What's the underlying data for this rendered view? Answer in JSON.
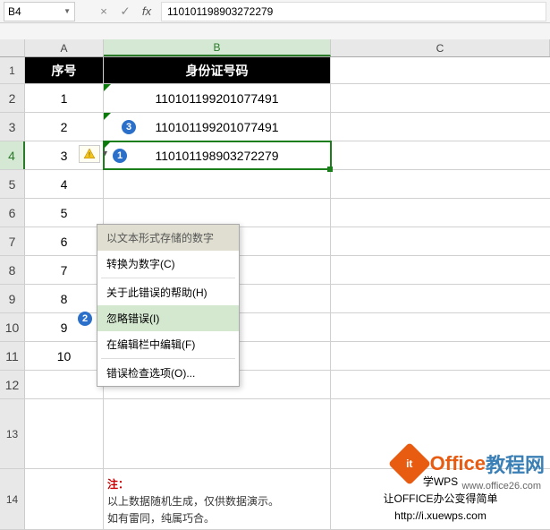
{
  "formula_bar": {
    "name_box": "B4",
    "cancel_icon": "×",
    "confirm_icon": "✓",
    "fx_label": "fx",
    "formula_value": "110101198903272279"
  },
  "columns": {
    "a": "A",
    "b": "B",
    "c": "C"
  },
  "row_headers": [
    "1",
    "2",
    "3",
    "4",
    "5",
    "6",
    "7",
    "8",
    "9",
    "10",
    "11",
    "12",
    "13",
    "14"
  ],
  "header_row": {
    "seq": "序号",
    "id": "身份证号码"
  },
  "rows": [
    {
      "seq": "1",
      "id": "110101199201077491"
    },
    {
      "seq": "2",
      "id": "110101199201077491"
    },
    {
      "seq": "3",
      "id": "110101198903272279"
    },
    {
      "seq": "4",
      "id": ""
    },
    {
      "seq": "5",
      "id": ""
    },
    {
      "seq": "6",
      "id": ""
    },
    {
      "seq": "7",
      "id": ""
    },
    {
      "seq": "8",
      "id": ""
    },
    {
      "seq": "9",
      "id": ""
    },
    {
      "seq": "10",
      "id": ""
    }
  ],
  "markers": {
    "m1": "1",
    "m2": "2",
    "m3": "3"
  },
  "context_menu": {
    "header": "以文本形式存储的数字",
    "convert": "转换为数字(C)",
    "help": "关于此错误的帮助(H)",
    "ignore": "忽略错误(I)",
    "edit": "在编辑栏中编辑(F)",
    "options": "错误检查选项(O)..."
  },
  "note": {
    "title": "注：",
    "line1": "以上数据随机生成，仅供数据演示。",
    "line2": "如有雷同，纯属巧合。"
  },
  "wps": {
    "line1": "学WPS",
    "line2": "让OFFICE办公变得简单",
    "line3": "http://i.xuewps.com"
  },
  "watermark": {
    "logo": "it",
    "part1": "Office",
    "part2": "教程网",
    "url": "www.office26.com"
  }
}
